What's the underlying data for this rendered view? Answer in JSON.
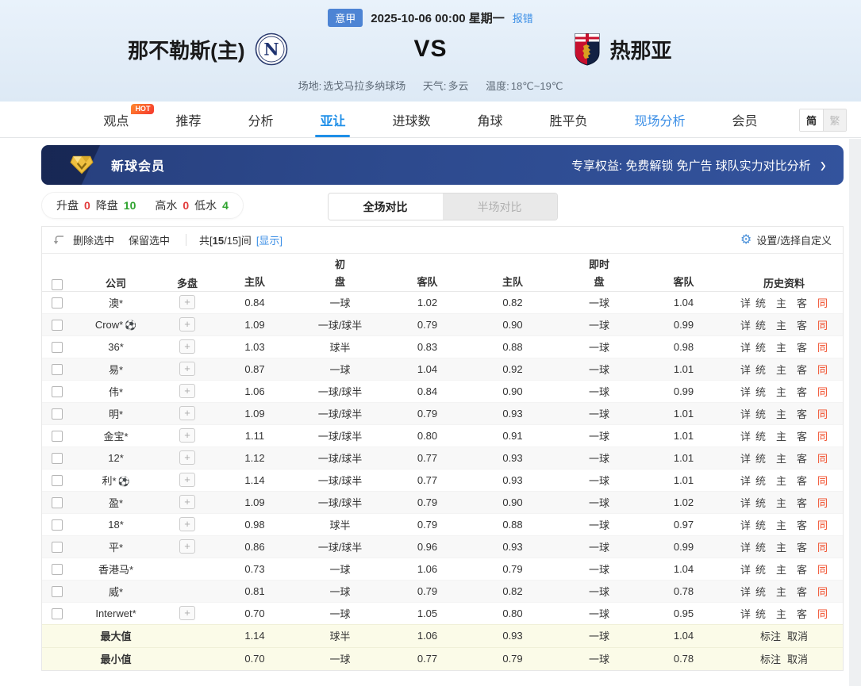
{
  "match": {
    "league_badge": "意甲",
    "datetime": "2025-10-06 00:00 星期一",
    "report_error": "报错",
    "home_team": "那不勒斯(主)",
    "vs": "VS",
    "away_team": "热那亚",
    "venue_label": "场地:",
    "venue": "选戈马拉多纳球场",
    "weather_label": "天气:",
    "weather": "多云",
    "temp_label": "温度:",
    "temperature": "18℃~19℃"
  },
  "nav": {
    "tabs": [
      {
        "label": "观点",
        "badge": "HOT"
      },
      {
        "label": "推荐"
      },
      {
        "label": "分析"
      },
      {
        "label": "亚让"
      },
      {
        "label": "进球数"
      },
      {
        "label": "角球"
      },
      {
        "label": "胜平负"
      },
      {
        "label": "现场分析"
      },
      {
        "label": "会员"
      }
    ],
    "lang": [
      "简",
      "繁"
    ]
  },
  "banner": {
    "title": "新球会员",
    "benefits": "专享权益: 免费解锁 免广告 球队实力对比分析"
  },
  "filters": {
    "up_label": "升盘",
    "up_value": "0",
    "down_label": "降盘",
    "down_value": "10",
    "high_label": "高水",
    "high_value": "0",
    "low_label": "低水",
    "low_value": "4"
  },
  "segmented": {
    "full": "全场对比",
    "half": "半场对比"
  },
  "controls": {
    "delete_selected": "删除选中",
    "keep_selected": "保留选中",
    "count_prefix": "共[",
    "count_bold": "15",
    "count_suffix": "/15]间",
    "show_link": "[显示]",
    "settings": "设置/选择自定义"
  },
  "table": {
    "headers": {
      "company": "公司",
      "multi": "多盘",
      "init_top": "初",
      "live_top": "即时",
      "sub_home": "主队",
      "sub_line": "盘",
      "sub_away": "客队",
      "history": "历史资料"
    },
    "history_links": [
      "详",
      "统",
      "主",
      "客",
      "同"
    ],
    "rows": [
      {
        "company": "澳*",
        "multi": true,
        "init": [
          "0.84",
          "一球",
          "1.02"
        ],
        "live": [
          "0.82",
          "一球",
          "1.04"
        ]
      },
      {
        "company": "Crow*",
        "ball": true,
        "multi": true,
        "init": [
          "1.09",
          "一球/球半",
          "0.79"
        ],
        "live": [
          "0.90",
          "一球",
          "0.99"
        ]
      },
      {
        "company": "36*",
        "multi": true,
        "init": [
          "1.03",
          "球半",
          "0.83"
        ],
        "live": [
          "0.88",
          "一球",
          "0.98"
        ]
      },
      {
        "company": "易*",
        "multi": true,
        "init": [
          "0.87",
          "一球",
          "1.04"
        ],
        "live": [
          "0.92",
          "一球",
          "1.01"
        ]
      },
      {
        "company": "伟*",
        "multi": true,
        "init": [
          "1.06",
          "一球/球半",
          "0.84"
        ],
        "live": [
          "0.90",
          "一球",
          "0.99"
        ]
      },
      {
        "company": "明*",
        "multi": true,
        "init": [
          "1.09",
          "一球/球半",
          "0.79"
        ],
        "live": [
          "0.93",
          "一球",
          "1.01"
        ]
      },
      {
        "company": "金宝*",
        "multi": true,
        "init": [
          "1.11",
          "一球/球半",
          "0.80"
        ],
        "live": [
          "0.91",
          "一球",
          "1.01"
        ]
      },
      {
        "company": "12*",
        "multi": true,
        "init": [
          "1.12",
          "一球/球半",
          "0.77"
        ],
        "live": [
          "0.93",
          "一球",
          "1.01"
        ]
      },
      {
        "company": "利*",
        "ball": true,
        "multi": true,
        "init": [
          "1.14",
          "一球/球半",
          "0.77"
        ],
        "live": [
          "0.93",
          "一球",
          "1.01"
        ]
      },
      {
        "company": "盈*",
        "multi": true,
        "init": [
          "1.09",
          "一球/球半",
          "0.79"
        ],
        "live": [
          "0.90",
          "一球",
          "1.02"
        ]
      },
      {
        "company": "18*",
        "multi": true,
        "init": [
          "0.98",
          "球半",
          "0.79"
        ],
        "live": [
          "0.88",
          "一球",
          "0.97"
        ]
      },
      {
        "company": "平*",
        "multi": true,
        "init": [
          "0.86",
          "一球/球半",
          "0.96"
        ],
        "live": [
          "0.93",
          "一球",
          "0.99"
        ]
      },
      {
        "company": "香港马*",
        "multi": false,
        "init": [
          "0.73",
          "一球",
          "1.06"
        ],
        "live": [
          "0.79",
          "一球",
          "1.04"
        ]
      },
      {
        "company": "威*",
        "multi": false,
        "init": [
          "0.81",
          "一球",
          "0.79"
        ],
        "live": [
          "0.82",
          "一球",
          "0.78"
        ]
      },
      {
        "company": "Interwet*",
        "multi": true,
        "init": [
          "0.70",
          "一球",
          "1.05"
        ],
        "live": [
          "0.80",
          "一球",
          "0.95"
        ]
      }
    ],
    "summary": [
      {
        "label": "最大值",
        "init": [
          "1.14",
          "球半",
          "1.06"
        ],
        "live": [
          "0.93",
          "一球",
          "1.04"
        ],
        "actions": [
          "标注",
          "取消"
        ]
      },
      {
        "label": "最小值",
        "init": [
          "0.70",
          "一球",
          "0.77"
        ],
        "live": [
          "0.79",
          "一球",
          "0.78"
        ],
        "actions": [
          "标注",
          "取消"
        ]
      }
    ]
  },
  "icons": {
    "ball": "⚽",
    "gear": "⚙",
    "chevron": "›",
    "plus": "+"
  },
  "colors": {
    "accent_blue": "#1f8fe8",
    "banner_blue": "#2d4a8e",
    "up_red": "#e23b3b",
    "down_green": "#2fa32f",
    "link_blue": "#3a8ee6",
    "same_red": "#f04b28",
    "summary_bg": "#fbfbe8"
  }
}
